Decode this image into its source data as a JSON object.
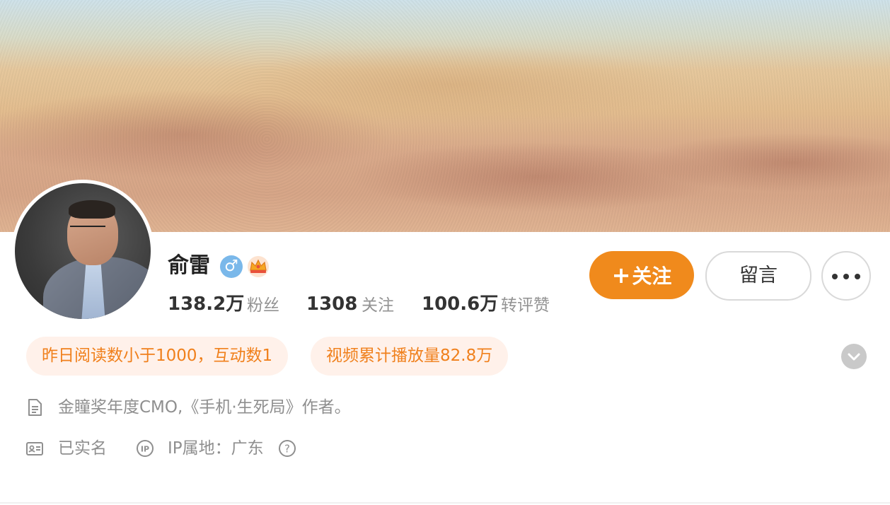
{
  "profile": {
    "name": "俞雷",
    "gender_icon": "male-icon",
    "badge_icon": "crown-icon",
    "avatar_icon": "avatar-photo"
  },
  "stats": [
    {
      "value": "138.2万",
      "label": "粉丝"
    },
    {
      "value": "1308",
      "label": "关注"
    },
    {
      "value": "100.6万",
      "label": "转评赞"
    }
  ],
  "actions": {
    "follow_label": "关注",
    "follow_plus": "+",
    "message_label": "留言",
    "more_icon": "more-icon"
  },
  "tags": [
    "昨日阅读数小于1000，互动数1",
    "视频累计播放量82.8万"
  ],
  "bio": {
    "icon": "document-icon",
    "text": "金瞳奖年度CMO,《手机·生死局》作者。"
  },
  "verification": {
    "realname_icon": "id-card-icon",
    "realname_text": "已实名",
    "ip_icon": "ip-icon",
    "ip_text": "IP属地：广东",
    "help_icon": "help-icon"
  },
  "colors": {
    "accent": "#f08a1c",
    "tag_bg": "#fff1ea",
    "gender": "#7ab8ea"
  }
}
